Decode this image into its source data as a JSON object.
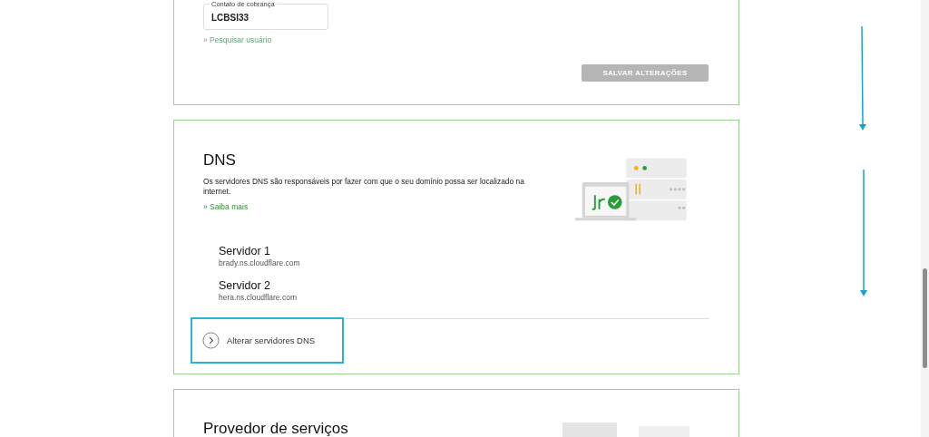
{
  "billing": {
    "field": {
      "label": "Contato de cobrança",
      "value": "LCBSI33"
    },
    "link": {
      "mark": "»",
      "label": "Pesquisar usuário"
    },
    "save_button": {
      "label": "SALVAR ALTERAÇÕES",
      "disabled": true
    }
  },
  "dns": {
    "title": "DNS",
    "description": "Os servidores DNS são responsáveis por fazer com que o seu domínio possa ser localizado na internet.",
    "link": {
      "mark": "»",
      "label": "Saiba mais"
    },
    "servers": [
      {
        "name": "Servidor 1",
        "host": "brady.ns.cloudflare.com"
      },
      {
        "name": "Servidor 2",
        "host": "hera.ns.cloudflare.com"
      }
    ],
    "action": {
      "label": "Alterar servidores DNS",
      "highlighted": true
    }
  },
  "provider": {
    "title": "Provedor de serviços"
  }
}
